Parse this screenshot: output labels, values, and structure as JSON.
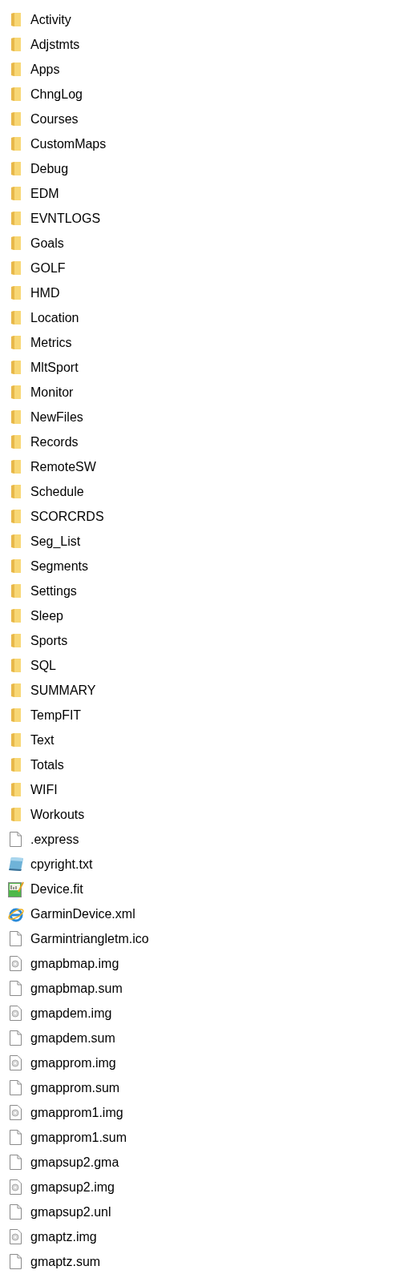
{
  "files": [
    {
      "name": "Activity",
      "kind": "folder"
    },
    {
      "name": "Adjstmts",
      "kind": "folder"
    },
    {
      "name": "Apps",
      "kind": "folder"
    },
    {
      "name": "ChngLog",
      "kind": "folder"
    },
    {
      "name": "Courses",
      "kind": "folder"
    },
    {
      "name": "CustomMaps",
      "kind": "folder"
    },
    {
      "name": "Debug",
      "kind": "folder"
    },
    {
      "name": "EDM",
      "kind": "folder"
    },
    {
      "name": "EVNTLOGS",
      "kind": "folder"
    },
    {
      "name": "Goals",
      "kind": "folder"
    },
    {
      "name": "GOLF",
      "kind": "folder"
    },
    {
      "name": "HMD",
      "kind": "folder"
    },
    {
      "name": "Location",
      "kind": "folder"
    },
    {
      "name": "Metrics",
      "kind": "folder"
    },
    {
      "name": "MltSport",
      "kind": "folder"
    },
    {
      "name": "Monitor",
      "kind": "folder"
    },
    {
      "name": "NewFiles",
      "kind": "folder"
    },
    {
      "name": "Records",
      "kind": "folder"
    },
    {
      "name": "RemoteSW",
      "kind": "folder"
    },
    {
      "name": "Schedule",
      "kind": "folder"
    },
    {
      "name": "SCORCRDS",
      "kind": "folder"
    },
    {
      "name": "Seg_List",
      "kind": "folder"
    },
    {
      "name": "Segments",
      "kind": "folder"
    },
    {
      "name": "Settings",
      "kind": "folder"
    },
    {
      "name": "Sleep",
      "kind": "folder"
    },
    {
      "name": "Sports",
      "kind": "folder"
    },
    {
      "name": "SQL",
      "kind": "folder"
    },
    {
      "name": "SUMMARY",
      "kind": "folder"
    },
    {
      "name": "TempFIT",
      "kind": "folder"
    },
    {
      "name": "Text",
      "kind": "folder"
    },
    {
      "name": "Totals",
      "kind": "folder"
    },
    {
      "name": "WIFI",
      "kind": "folder"
    },
    {
      "name": "Workouts",
      "kind": "folder"
    },
    {
      "name": ".express",
      "kind": "file"
    },
    {
      "name": "cpyright.txt",
      "kind": "text"
    },
    {
      "name": "Device.fit",
      "kind": "chart"
    },
    {
      "name": "GarminDevice.xml",
      "kind": "web"
    },
    {
      "name": "Garmintriangletm.ico",
      "kind": "file"
    },
    {
      "name": "gmapbmap.img",
      "kind": "disc"
    },
    {
      "name": "gmapbmap.sum",
      "kind": "file"
    },
    {
      "name": "gmapdem.img",
      "kind": "disc"
    },
    {
      "name": "gmapdem.sum",
      "kind": "file"
    },
    {
      "name": "gmapprom.img",
      "kind": "disc"
    },
    {
      "name": "gmapprom.sum",
      "kind": "file"
    },
    {
      "name": "gmapprom1.img",
      "kind": "disc"
    },
    {
      "name": "gmapprom1.sum",
      "kind": "file"
    },
    {
      "name": "gmapsup2.gma",
      "kind": "file"
    },
    {
      "name": "gmapsup2.img",
      "kind": "disc"
    },
    {
      "name": "gmapsup2.unl",
      "kind": "file"
    },
    {
      "name": "gmaptz.img",
      "kind": "disc"
    },
    {
      "name": "gmaptz.sum",
      "kind": "file"
    }
  ]
}
